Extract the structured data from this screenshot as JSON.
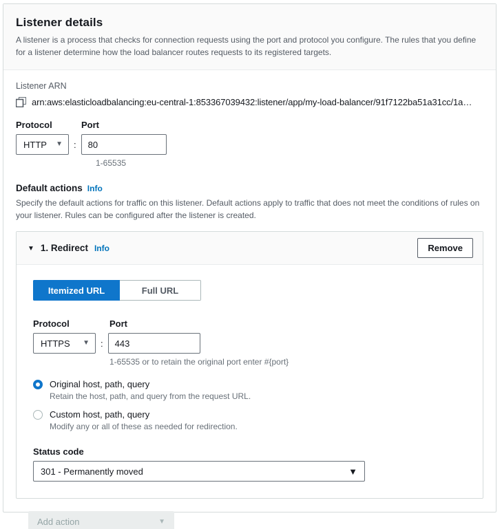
{
  "card": {
    "title": "Listener details",
    "description": "A listener is a process that checks for connection requests using the port and protocol you configure. The rules that you define for a listener determine how the load balancer routes requests to its registered targets."
  },
  "listener_arn": {
    "label": "Listener ARN",
    "copy_icon": "copy-icon",
    "value": "arn:aws:elasticloadbalancing:eu-central-1:853367039432:listener/app/my-load-balancer/91f7122ba51a31cc/1a…"
  },
  "listener": {
    "protocol_label": "Protocol",
    "protocol_value": "HTTP",
    "separator": ":",
    "port_label": "Port",
    "port_value": "80",
    "port_hint": "1-65535",
    "caret_icon": "chevron-down-icon"
  },
  "default_actions": {
    "heading": "Default actions",
    "info_label": "Info",
    "description": "Specify the default actions for traffic on this listener. Default actions apply to traffic that does not meet the conditions of rules on your listener. Rules can be configured after the listener is created."
  },
  "action": {
    "disclosure_icon": "triangle-down-icon",
    "title": "1. Redirect",
    "info_label": "Info",
    "remove_label": "Remove",
    "tabs": [
      {
        "label": "Itemized URL",
        "active": true
      },
      {
        "label": "Full URL",
        "active": false
      }
    ],
    "protocol_label": "Protocol",
    "protocol_value": "HTTPS",
    "separator": ":",
    "port_label": "Port",
    "port_value": "443",
    "port_hint": "1-65535 or to retain the original port enter #{port}",
    "radios": [
      {
        "label": "Original host, path, query",
        "description": "Retain the host, path, and query from the request URL.",
        "selected": true
      },
      {
        "label": "Custom host, path, query",
        "description": "Modify any or all of these as needed for redirection.",
        "selected": false
      }
    ],
    "status_code_label": "Status code",
    "status_code_value": "301 - Permanently moved"
  },
  "add_action": {
    "label": "Add action",
    "caret_icon": "chevron-down-icon"
  },
  "colors": {
    "accent_blue": "#0f76cb",
    "info_link": "#0073bb",
    "border": "#d5dbdb",
    "text": "#16191f",
    "muted": "#545b64",
    "disabled_bg": "#eaeded"
  }
}
